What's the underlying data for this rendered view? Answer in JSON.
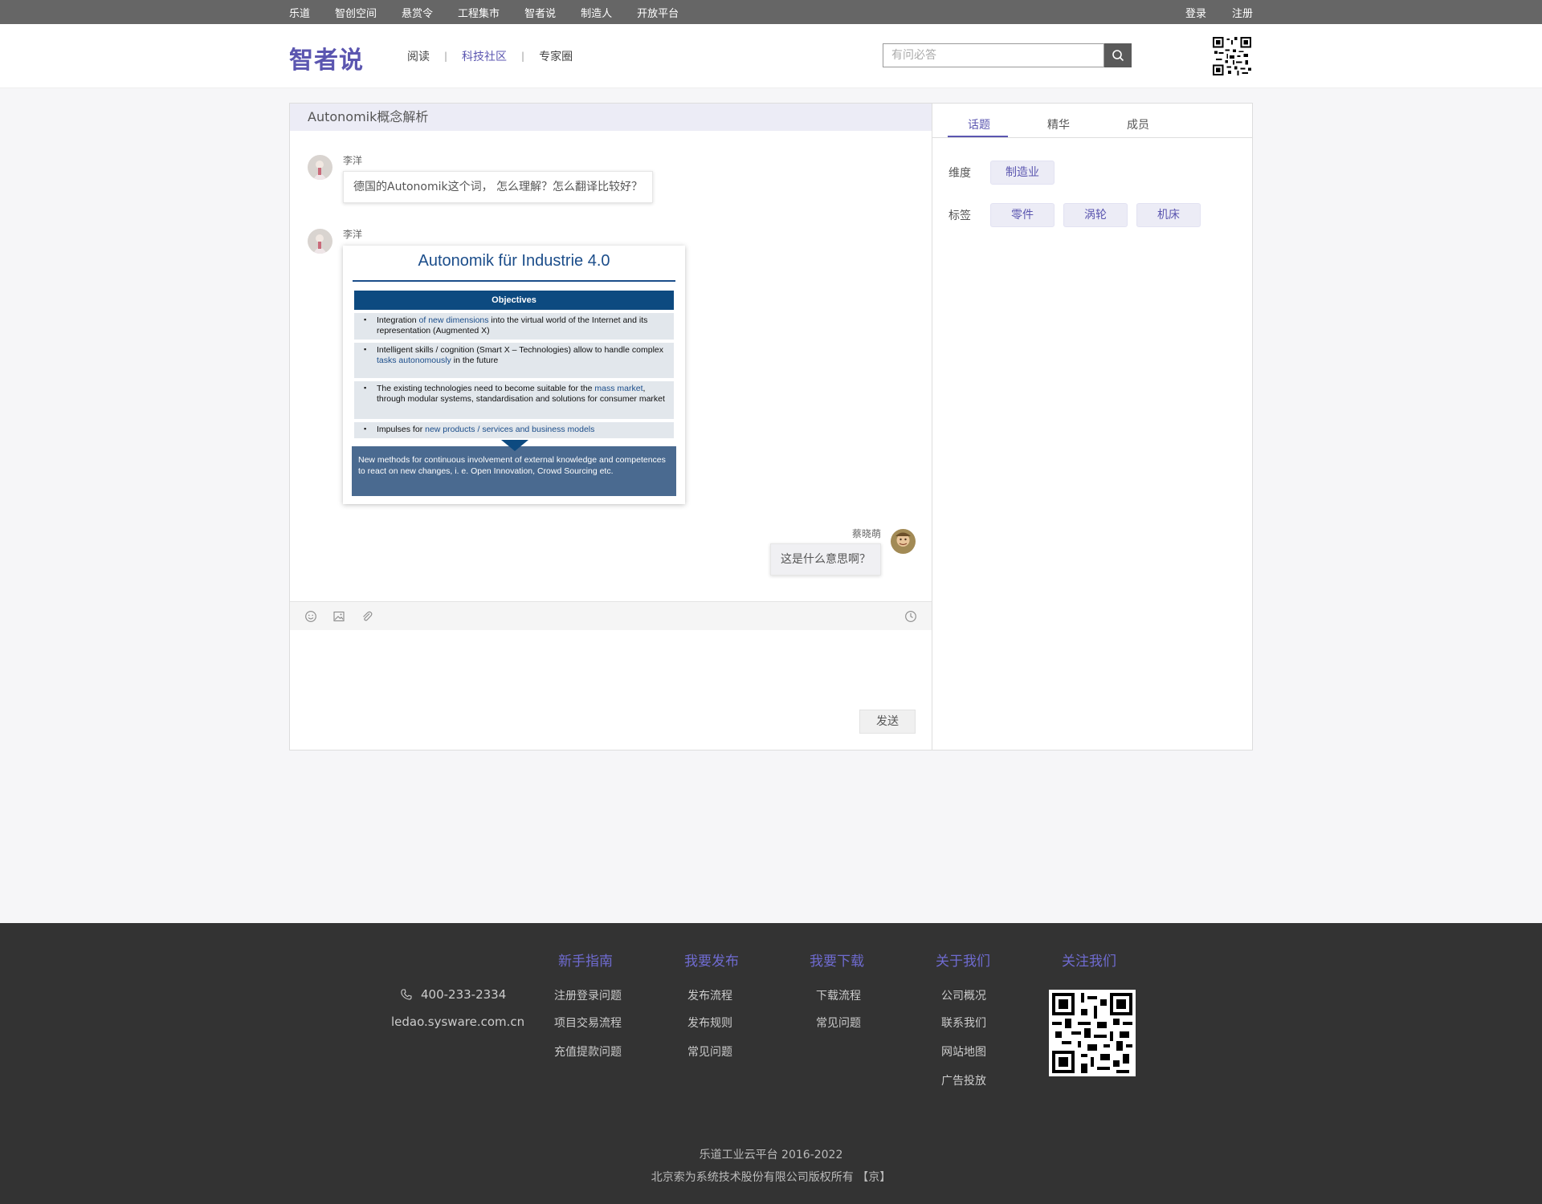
{
  "topbar": {
    "links": [
      "乐道",
      "智创空间",
      "悬赏令",
      "工程集市",
      "智者说",
      "制造人",
      "开放平台"
    ],
    "login": "登录",
    "register": "注册"
  },
  "header": {
    "logo": "智者说",
    "nav": [
      "阅读",
      "科技社区",
      "专家圈"
    ],
    "nav_active": "科技社区",
    "search_placeholder": "有问必答"
  },
  "chat": {
    "title": "Autonomik概念解析",
    "messages": [
      {
        "user": "李洋",
        "text": "德国的Autonomik这个词， 怎么理解？怎么翻译比较好？"
      },
      {
        "user": "李洋",
        "type": "image"
      },
      {
        "user": "蔡晓萌",
        "text": "这是什么意思啊？"
      }
    ],
    "slide": {
      "title": "Autonomik für Industrie 4.0",
      "objectives_header": "Objectives",
      "obj1_a": "Integration ",
      "obj1_b": "of new dimensions",
      "obj1_c": " into the virtual world of the Internet and its representation (Augmented X)",
      "obj2_a": "Intelligent skills / cognition (Smart X – Technologies) allow to handle complex ",
      "obj2_b": "tasks autonomously",
      "obj2_c": " in the future",
      "obj3_a": "The existing technologies need to become suitable for the ",
      "obj3_b": "mass market",
      "obj3_c": ", through modular systems, standardisation and solutions for consumer market",
      "obj4_a": "Impulses for ",
      "obj4_b": "new products / services and business models",
      "footer": "New methods for continuous involvement of external knowledge and competences to react on new changes, i. e. Open Innovation, Crowd Sourcing etc."
    },
    "send": "发送"
  },
  "side": {
    "tabs": [
      "话题",
      "精华",
      "成员"
    ],
    "active_tab": "话题",
    "dimension_label": "维度",
    "dimension": "制造业",
    "tags_label": "标签",
    "tags": [
      "零件",
      "涡轮",
      "机床"
    ]
  },
  "footer": {
    "columns": [
      {
        "title": "新手指南",
        "links": [
          "注册登录问题",
          "项目交易流程",
          "充值提款问题"
        ]
      },
      {
        "title": "我要发布",
        "links": [
          "发布流程",
          "发布规则",
          "常见问题"
        ]
      },
      {
        "title": "我要下载",
        "links": [
          "下载流程",
          "常见问题"
        ]
      },
      {
        "title": "关于我们",
        "links": [
          "公司概况",
          "联系我们",
          "网站地图",
          "广告投放"
        ]
      },
      {
        "title": "关注我们",
        "links": []
      }
    ],
    "phone": "400-233-2334",
    "site": "ledao.sysware.com.cn",
    "copyright1": "乐道工业云平台 2016-2022",
    "copyright2": "北京索为系统技术股份有限公司版权所有 【京】"
  },
  "colors": {
    "accent": "#5b56b0",
    "topbar": "#666666",
    "footer": "#333333",
    "slide_blue": "#0d4a80"
  },
  "icons": [
    "search-icon",
    "qr-code-icon",
    "emoji-icon",
    "image-icon",
    "attachment-icon",
    "clock-icon",
    "phone-icon"
  ]
}
